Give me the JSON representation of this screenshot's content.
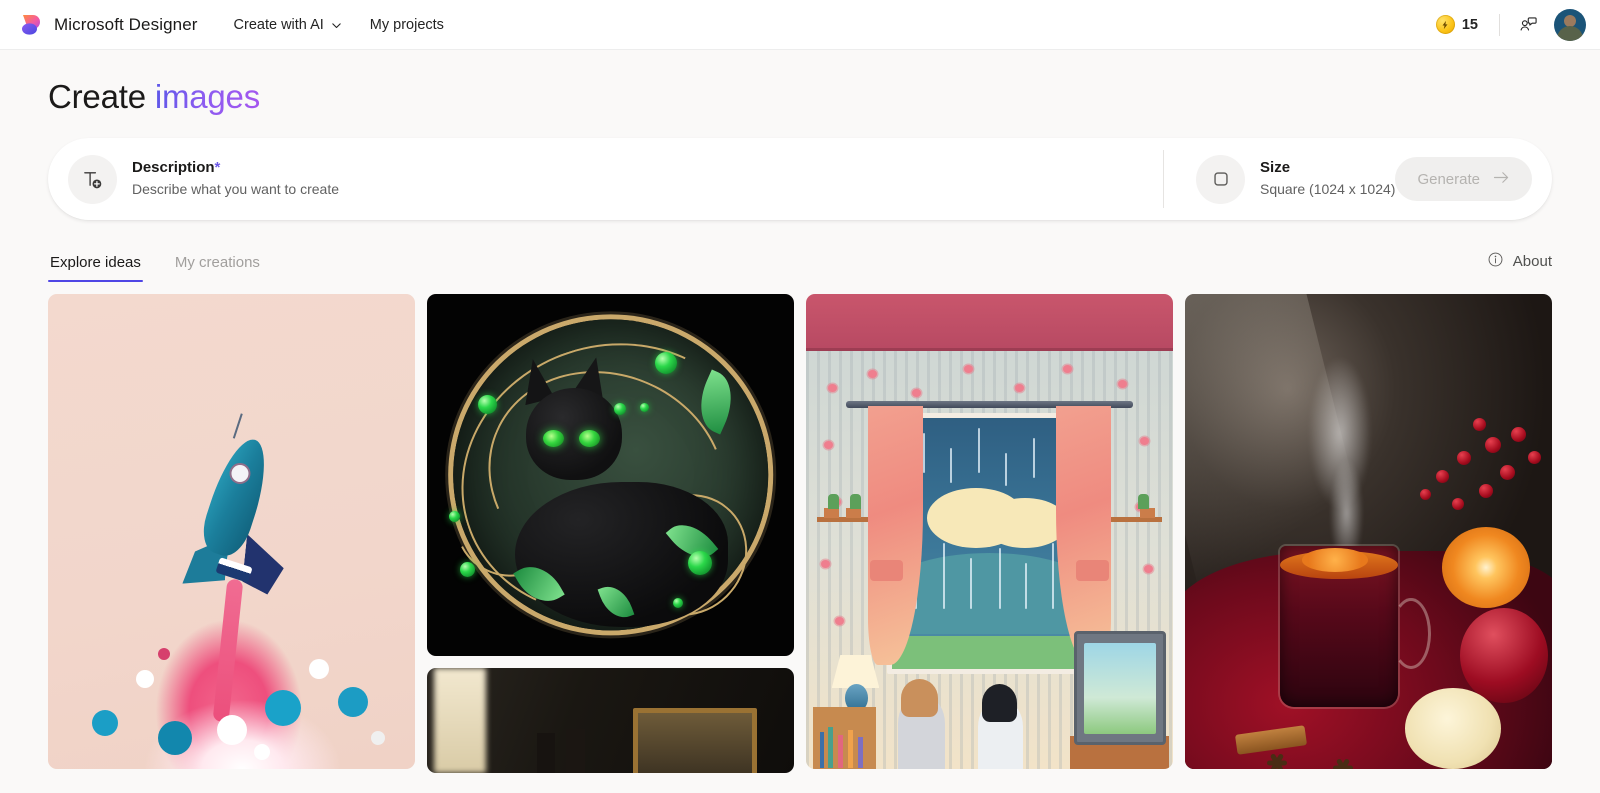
{
  "topbar": {
    "logo_icon": "designer-logo-icon",
    "brand": "Microsoft Designer",
    "nav": [
      {
        "label": "Create with AI",
        "icon": "chevron-down-icon",
        "has_chevron": true
      },
      {
        "label": "My projects",
        "has_chevron": false
      }
    ],
    "credits": {
      "icon": "lightning-coin-icon",
      "count": "15"
    },
    "feedback_icon": "person-feedback-icon",
    "avatar": "user-avatar"
  },
  "page": {
    "title_primary": "Create",
    "title_accent": "images",
    "accent_color": "#8b5cf0"
  },
  "prompt_bar": {
    "description": {
      "icon": "add-text-icon",
      "label": "Description",
      "required_marker": "*",
      "placeholder": "Describe what you want to create",
      "value": ""
    },
    "size": {
      "icon": "square-shape-icon",
      "label": "Size",
      "value": "Square (1024 x 1024)"
    },
    "generate": {
      "label": "Generate",
      "icon": "arrow-right-icon",
      "disabled": true
    }
  },
  "tabs": [
    {
      "label": "Explore ideas",
      "active": true
    },
    {
      "label": "My creations",
      "active": false
    }
  ],
  "about": {
    "icon": "info-circle-icon",
    "label": "About"
  },
  "gallery": {
    "columns": [
      {
        "cards": [
          {
            "name": "rocket-illustration",
            "art": "rocket",
            "size": "tall",
            "alt": "Teal rocket launching with pink swirling exhaust on peach background"
          }
        ]
      },
      {
        "cards": [
          {
            "name": "ornate-black-cat",
            "art": "cat",
            "size": "sq",
            "alt": "Ornate black cat with green eyes, gold filigree and emerald gems"
          },
          {
            "name": "dark-interior-painting",
            "art": "interior",
            "size": "part",
            "alt": "Dark interior scene with framed painting"
          }
        ]
      },
      {
        "cards": [
          {
            "name": "pixel-art-rainy-room",
            "art": "room",
            "size": "tall",
            "alt": "Pixel art cozy room with two children gaming by a rainy window"
          }
        ]
      },
      {
        "cards": [
          {
            "name": "mulled-wine-still-life",
            "art": "wine",
            "size": "tall",
            "alt": "Steaming mulled wine with berries, orange slice, apples, cinnamon and star anise"
          }
        ]
      }
    ]
  }
}
